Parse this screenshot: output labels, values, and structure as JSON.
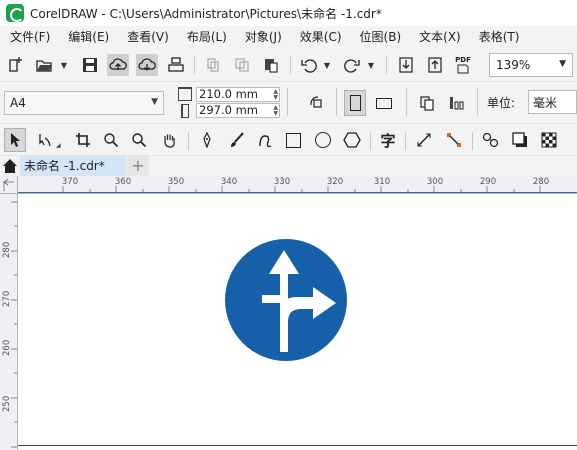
{
  "window": {
    "title": "CorelDRAW - C:\\Users\\Administrator\\Pictures\\未命名 -1.cdr*"
  },
  "menu": [
    {
      "label": "文件(F)"
    },
    {
      "label": "编辑(E)"
    },
    {
      "label": "查看(V)"
    },
    {
      "label": "布局(L)"
    },
    {
      "label": "对象(J)"
    },
    {
      "label": "效果(C)"
    },
    {
      "label": "位图(B)"
    },
    {
      "label": "文本(X)"
    },
    {
      "label": "表格(T)"
    }
  ],
  "toolbar": {
    "pdf_label": "PDF",
    "zoom_value": "139%"
  },
  "property_bar": {
    "page_size": "A4",
    "width": "210.0 mm",
    "height": "297.0 mm",
    "unit_label": "单位:",
    "unit_value": "毫米"
  },
  "toolbox": {
    "text_tool_glyph": "字"
  },
  "tabs": {
    "document_tab": "未命名 -1.cdr*",
    "add_tab": "+"
  },
  "ruler": {
    "h_ticks": [
      "370",
      "360",
      "350",
      "340",
      "330",
      "320",
      "310",
      "300",
      "290",
      "280"
    ],
    "v_ticks": [
      "280",
      "270",
      "260",
      "250"
    ]
  },
  "colors": {
    "sign_blue": "#1660a9",
    "accent": "#2e6fb3",
    "tab_active": "#d3e5f6"
  }
}
